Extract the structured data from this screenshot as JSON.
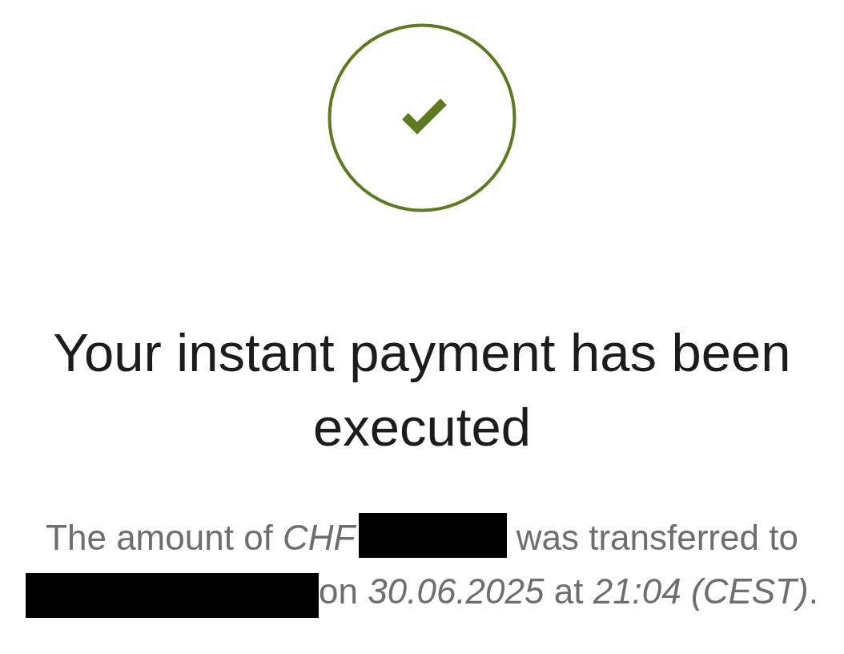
{
  "title": "Your instant payment has been executed",
  "message": {
    "parts": [
      {
        "kind": "text",
        "text": "The amount of *CHF*"
      },
      {
        "kind": "redacted"
      },
      {
        "kind": "text",
        "text": " was transferred to "
      },
      {
        "kind": "redacted"
      },
      {
        "kind": "text",
        "text": "on *30.06.2025* at *21:04 (CEST)*."
      }
    ]
  }
}
